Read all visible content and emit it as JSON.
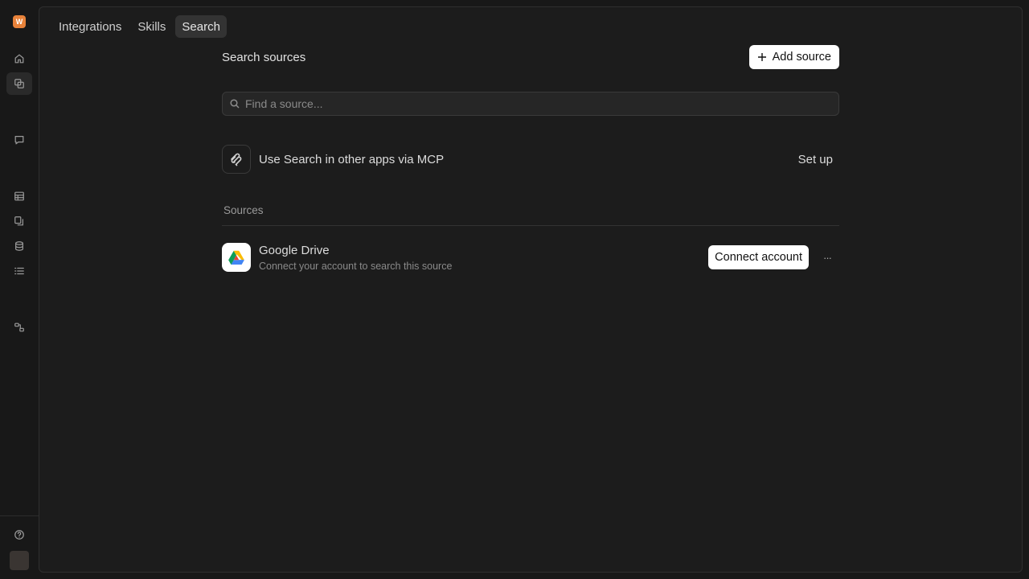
{
  "rail": {
    "logo_letter": "W",
    "icons": [
      "home-icon",
      "integrations-icon",
      "chat-icon",
      "table-icon",
      "documents-icon",
      "database-icon",
      "list-icon",
      "workflow-icon",
      "help-icon"
    ]
  },
  "tabs": [
    {
      "label": "Integrations",
      "active": false
    },
    {
      "label": "Skills",
      "active": false
    },
    {
      "label": "Search",
      "active": true
    }
  ],
  "main": {
    "title": "Search sources",
    "add_button_label": "Add source",
    "search_placeholder": "Find a source...",
    "mcp": {
      "label": "Use Search in other apps via MCP",
      "action_label": "Set up"
    },
    "sources_label": "Sources",
    "sources": [
      {
        "name": "Google Drive",
        "description": "Connect your account to search this source",
        "action_label": "Connect account",
        "more_label": "···"
      }
    ]
  },
  "colors": {
    "accent": "#e8823a",
    "background": "#181818",
    "panel": "#1c1c1c"
  }
}
